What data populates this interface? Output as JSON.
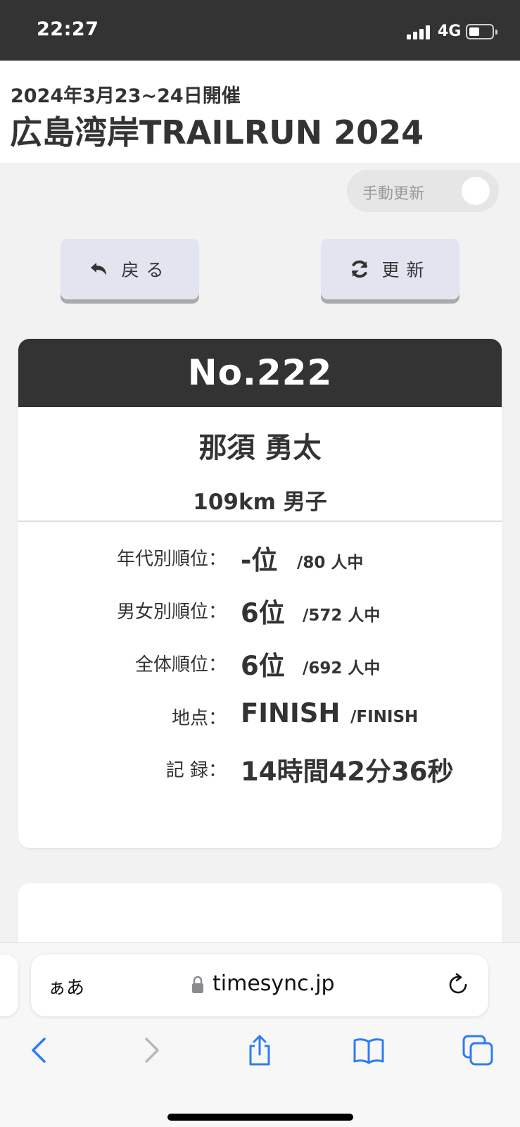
{
  "status_bar": {
    "time": "22:27",
    "network": "4G"
  },
  "header": {
    "date": "2024年3月23~24日開催",
    "title": "広島湾岸TRAILRUN 2024"
  },
  "toggle": {
    "label": "手動更新",
    "on": false
  },
  "buttons": {
    "back": "戻る",
    "refresh": "更新"
  },
  "runner": {
    "bib": "No.222",
    "name": "那須 勇太",
    "category": "109km 男子"
  },
  "results": [
    {
      "label": "年代別順位：",
      "value": "-位",
      "total": "/80 人中"
    },
    {
      "label": "男女別順位：",
      "value": "6位",
      "total": "/572 人中"
    },
    {
      "label": "全体順位：",
      "value": "6位",
      "total": "/692 人中"
    },
    {
      "label": "地点：",
      "value": "FINISH",
      "total": "/FINISH"
    },
    {
      "label": "記 録：",
      "value": "14時間42分36秒",
      "total": ""
    }
  ],
  "browser": {
    "text_size_label": "ぁあ",
    "url": "timesync.jp"
  },
  "colors": {
    "header_dark": "#333333",
    "button_bg": "#e2e5f0",
    "ios_blue": "#2f7bf5"
  }
}
